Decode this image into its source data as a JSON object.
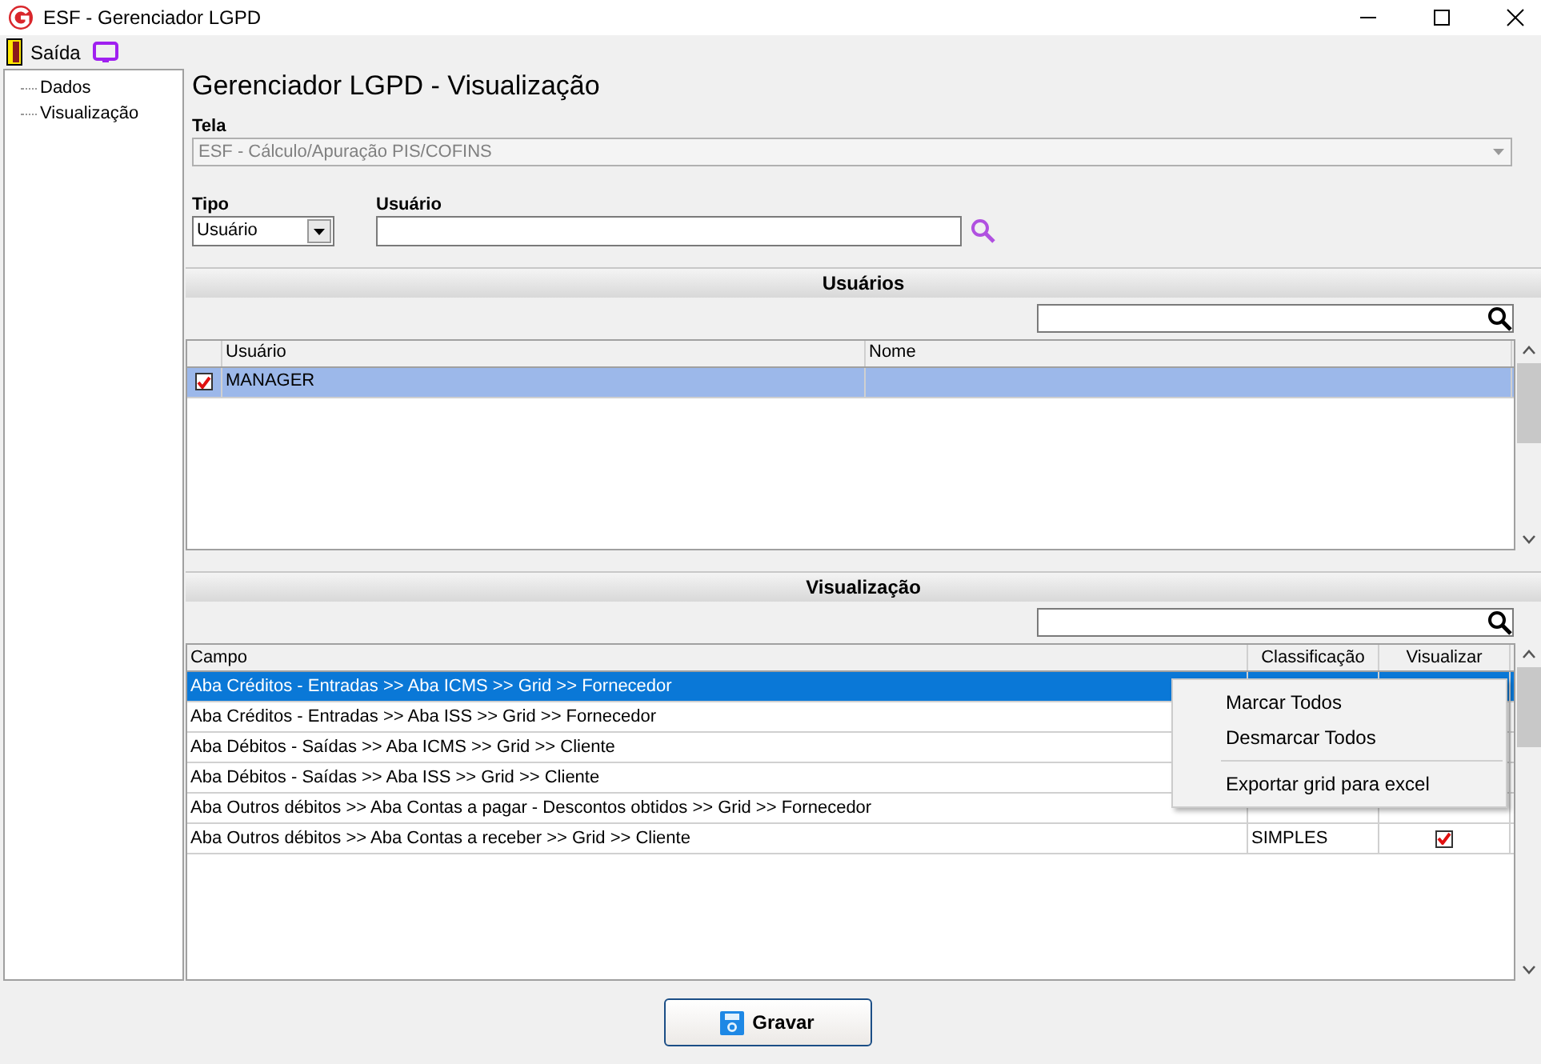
{
  "window": {
    "title": "ESF - Gerenciador LGPD"
  },
  "toolbar": {
    "exit_label": "Saída"
  },
  "tree": {
    "items": [
      {
        "label": "Dados"
      },
      {
        "label": "Visualização"
      }
    ]
  },
  "heading": "Gerenciador LGPD - Visualização",
  "tela": {
    "label": "Tela",
    "value": "ESF - Cálculo/Apuração PIS/COFINS",
    "disabled": true
  },
  "tipo": {
    "label": "Tipo",
    "value": "Usuário"
  },
  "usuario": {
    "label": "Usuário"
  },
  "users_section": {
    "title": "Usuários",
    "columns": [
      "Usuário",
      "Nome"
    ],
    "rows": [
      {
        "checked": true,
        "selected": true,
        "usuario": "MANAGER"
      }
    ]
  },
  "view_section": {
    "title": "Visualização",
    "columns": [
      "Campo",
      "Classificação",
      "Visualizar"
    ],
    "rows": [
      {
        "campo": "Aba Créditos - Entradas >> Aba ICMS >> Grid >> Fornecedor",
        "selected": true
      },
      {
        "campo": "Aba Créditos - Entradas >> Aba ISS >> Grid >> Fornecedor",
        "selected": false
      },
      {
        "campo": "Aba Débitos - Saídas >> Aba ICMS >> Grid >> Cliente",
        "selected": false
      },
      {
        "campo": "Aba Débitos - Saídas >> Aba ISS >> Grid >> Cliente",
        "selected": false
      },
      {
        "campo": "Aba Outros débitos >> Aba Contas a pagar - Descontos obtidos >> Grid >> Fornecedor",
        "selected": false
      },
      {
        "campo": "Aba Outros débitos >> Aba Contas a receber >> Grid >> Cliente",
        "selected": false,
        "classificacao": "SIMPLES",
        "visualizar": true
      }
    ]
  },
  "context_menu": {
    "items": [
      {
        "label": "Marcar Todos"
      },
      {
        "label": "Desmarcar Todos"
      },
      {
        "label": "Exportar grid para excel",
        "separator_before": true
      }
    ]
  },
  "save_button": "Gravar"
}
